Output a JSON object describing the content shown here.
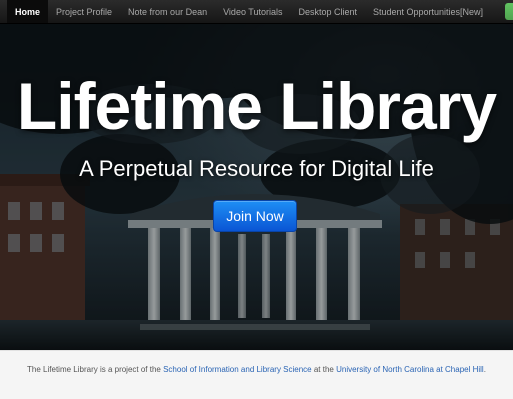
{
  "nav": {
    "items": [
      {
        "label": "Home",
        "active": true
      },
      {
        "label": "Project Profile",
        "active": false
      },
      {
        "label": "Note from our Dean",
        "active": false
      },
      {
        "label": "Video Tutorials",
        "active": false
      },
      {
        "label": "Desktop Client",
        "active": false
      },
      {
        "label": "Student Opportunities[New]",
        "active": false
      }
    ]
  },
  "hero": {
    "title": "Lifetime Library",
    "subtitle": "A Perpetual Resource for Digital Life",
    "button_label": "Join Now",
    "background_description_icon": "campus-well-photo"
  },
  "footer": {
    "prefix": "The Lifetime Library is a project of the ",
    "link1": "School of Information and Library Science",
    "middle": " at the ",
    "link2": "University of North Carolina at Chapel Hill",
    "suffix": "."
  },
  "colors": {
    "nav_bg": "#1c1c1c",
    "button_blue": "#0a6ee0",
    "link_blue": "#2a64b4",
    "footer_bg": "#f5f5f5"
  }
}
